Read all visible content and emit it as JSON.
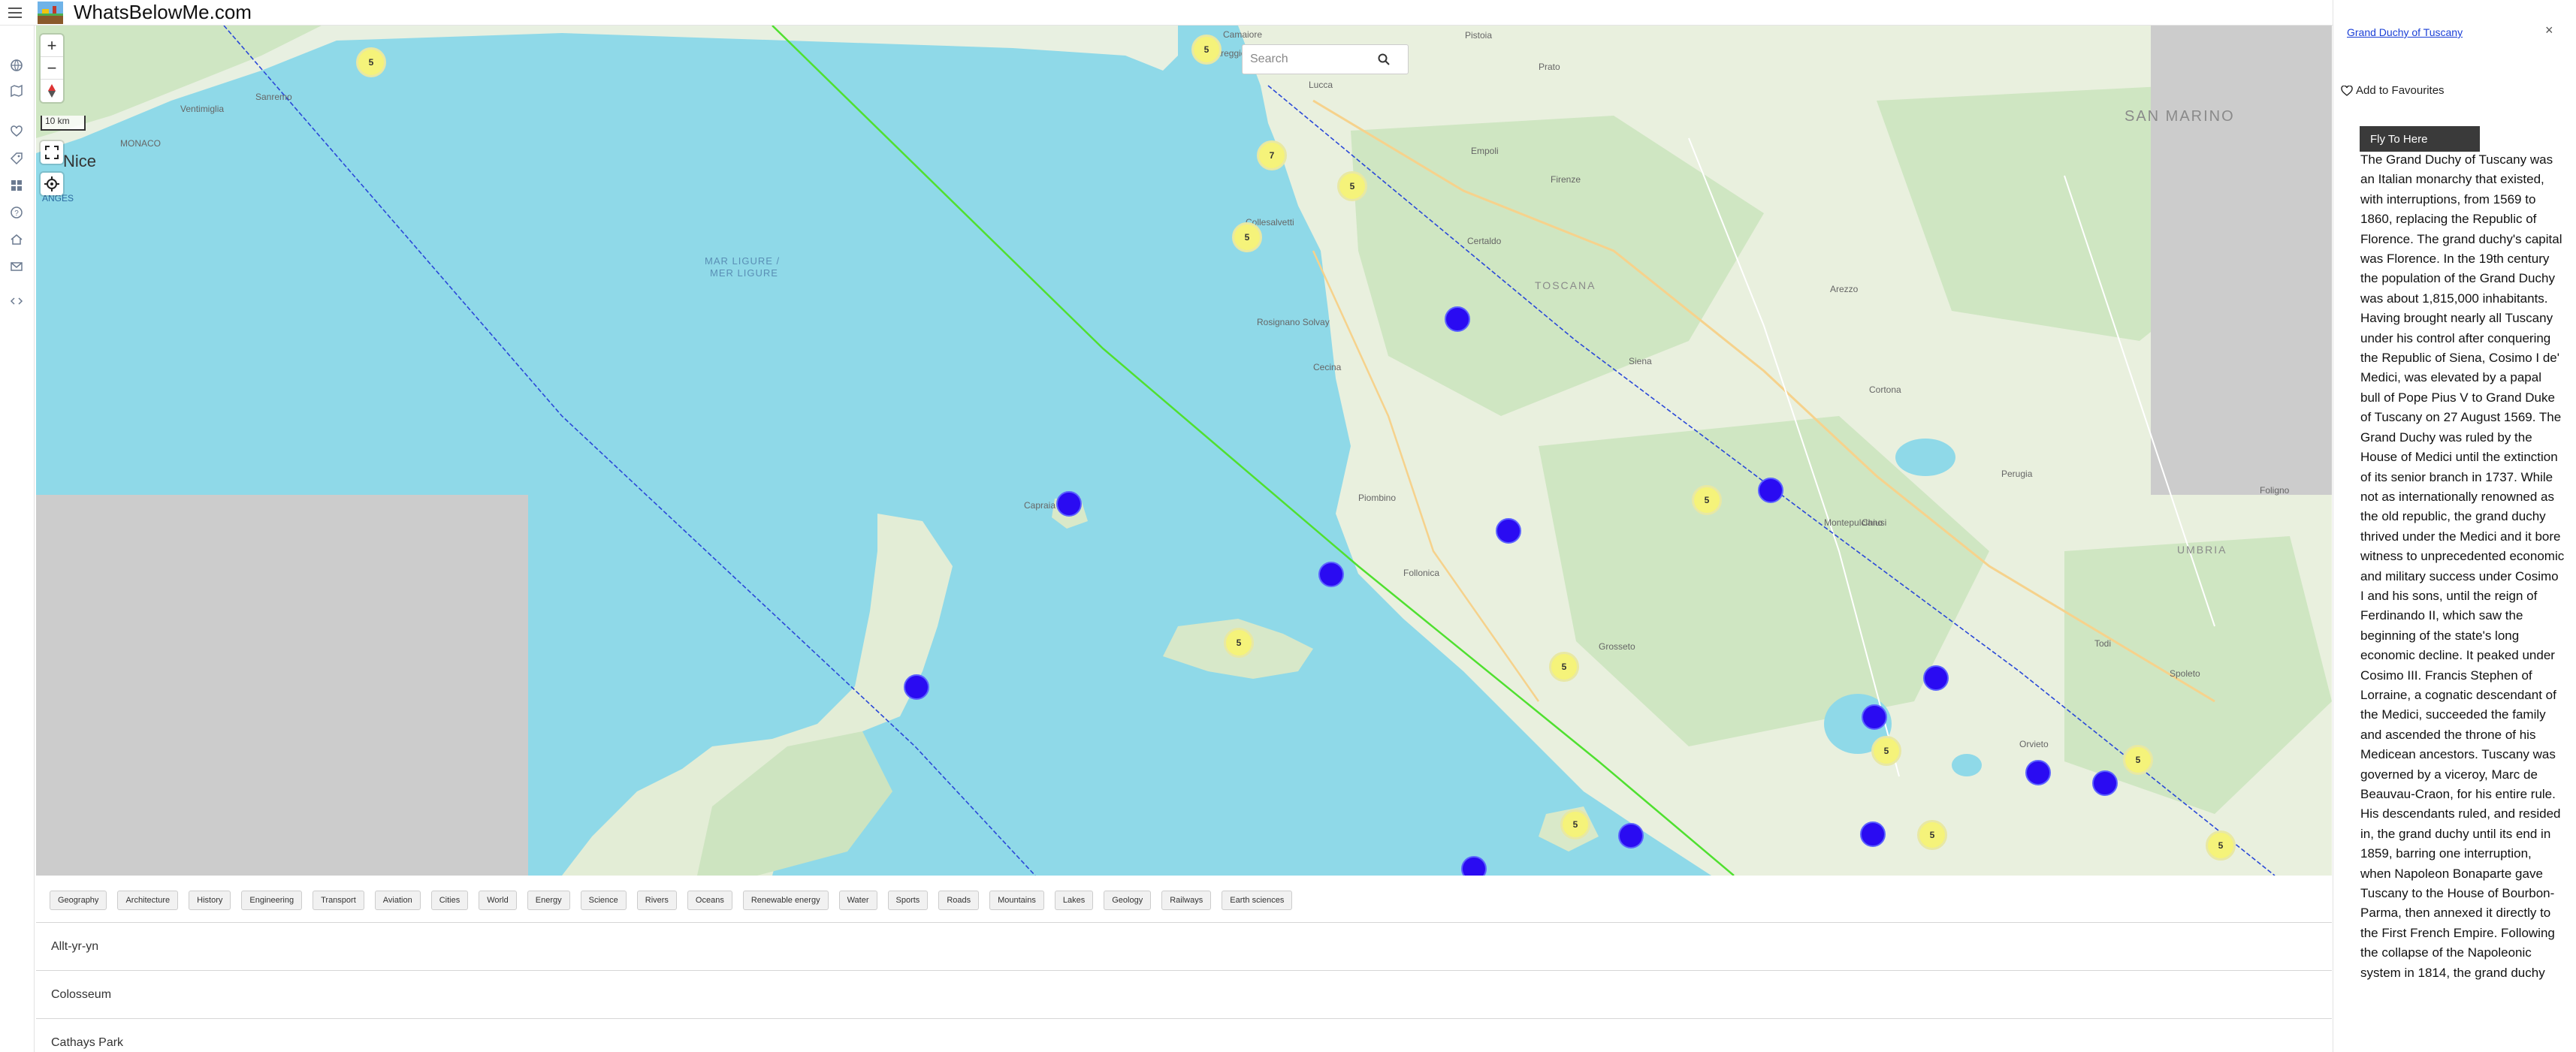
{
  "header": {
    "title": "WhatsBelowMe.com"
  },
  "map": {
    "search": {
      "placeholder": "Search"
    },
    "zoom": {
      "in": "+",
      "out": "−"
    },
    "scale": "10 km",
    "labels": {
      "nice": "Nice",
      "anges": "ANGES",
      "sea1": "MAR LIGURE /",
      "sea2": "MER LIGURE",
      "toscana": "TOSCANA",
      "sanmarino": "SAN MARINO",
      "umbria": "UMBRIA",
      "monaco": "MONACO",
      "sanremo": "Sanremo",
      "ventimiglia": "Ventimiglia",
      "camaiore": "Camaiore",
      "viareggio": "Viareggio",
      "lucca": "Lucca",
      "pistoia": "Pistoia",
      "prato": "Prato",
      "firenze": "Firenze",
      "empoli": "Empoli",
      "siena": "Siena",
      "arezzo": "Arezzo",
      "cortona": "Cortona",
      "perugia": "Perugia",
      "foligno": "Foligno",
      "todi": "Todi",
      "spoleto": "Spoleto",
      "orvieto": "Orvieto",
      "piombino": "Piombino",
      "grosseto": "Grosseto",
      "cecina": "Cecina",
      "rosignano": "Rosignano Solvay",
      "collesalvetti": "Collesalvetti",
      "montepulciano": "Montepulciano",
      "chiusi": "Chiusi",
      "follonica": "Follonica",
      "ceraldo": "Certaldo",
      "capraia": "Capraia"
    }
  },
  "categories": [
    "Geography",
    "Architecture",
    "History",
    "Engineering",
    "Transport",
    "Aviation",
    "Cities",
    "World",
    "Energy",
    "Science",
    "Rivers",
    "Oceans",
    "Renewable energy",
    "Water",
    "Sports",
    "Roads",
    "Mountains",
    "Lakes",
    "Geology",
    "Railways",
    "Earth sciences"
  ],
  "list": [
    "Allt-yr-yn",
    "Colosseum",
    "Cathays Park"
  ],
  "panel": {
    "title": "Grand Duchy of Tuscany",
    "close": "×",
    "favourite": "Add to Favourites",
    "fly": "Fly To Here",
    "description": "The Grand Duchy of Tuscany was an Italian monarchy that existed, with interruptions, from 1569 to 1860, replacing the Republic of Florence. The grand duchy's capital was Florence. In the 19th century the population of the Grand Duchy was about 1,815,000 inhabitants. Having brought nearly all Tuscany under his control after conquering the Republic of Siena, Cosimo I de' Medici, was elevated by a papal bull of Pope Pius V to Grand Duke of Tuscany on 27 August 1569. The Grand Duchy was ruled by the House of Medici until the extinction of its senior branch in 1737. While not as internationally renowned as the old republic, the grand duchy thrived under the Medici and it bore witness to unprecedented economic and military success under Cosimo I and his sons, until the reign of Ferdinando II, which saw the beginning of the state's long economic decline. It peaked under Cosimo III. Francis Stephen of Lorraine, a cognatic descendant of the Medici, succeeded the family and ascended the throne of his Medicean ancestors. Tuscany was governed by a viceroy, Marc de Beauvau-Craon, for his entire rule. His descendants ruled, and resided in, the grand duchy until its end in 1859, barring one interruption, when Napoleon Bonaparte gave Tuscany to the House of Bourbon-Parma, then annexed it directly to the First French Empire. Following the collapse of the Napoleonic system in 1814, the grand duchy"
  }
}
